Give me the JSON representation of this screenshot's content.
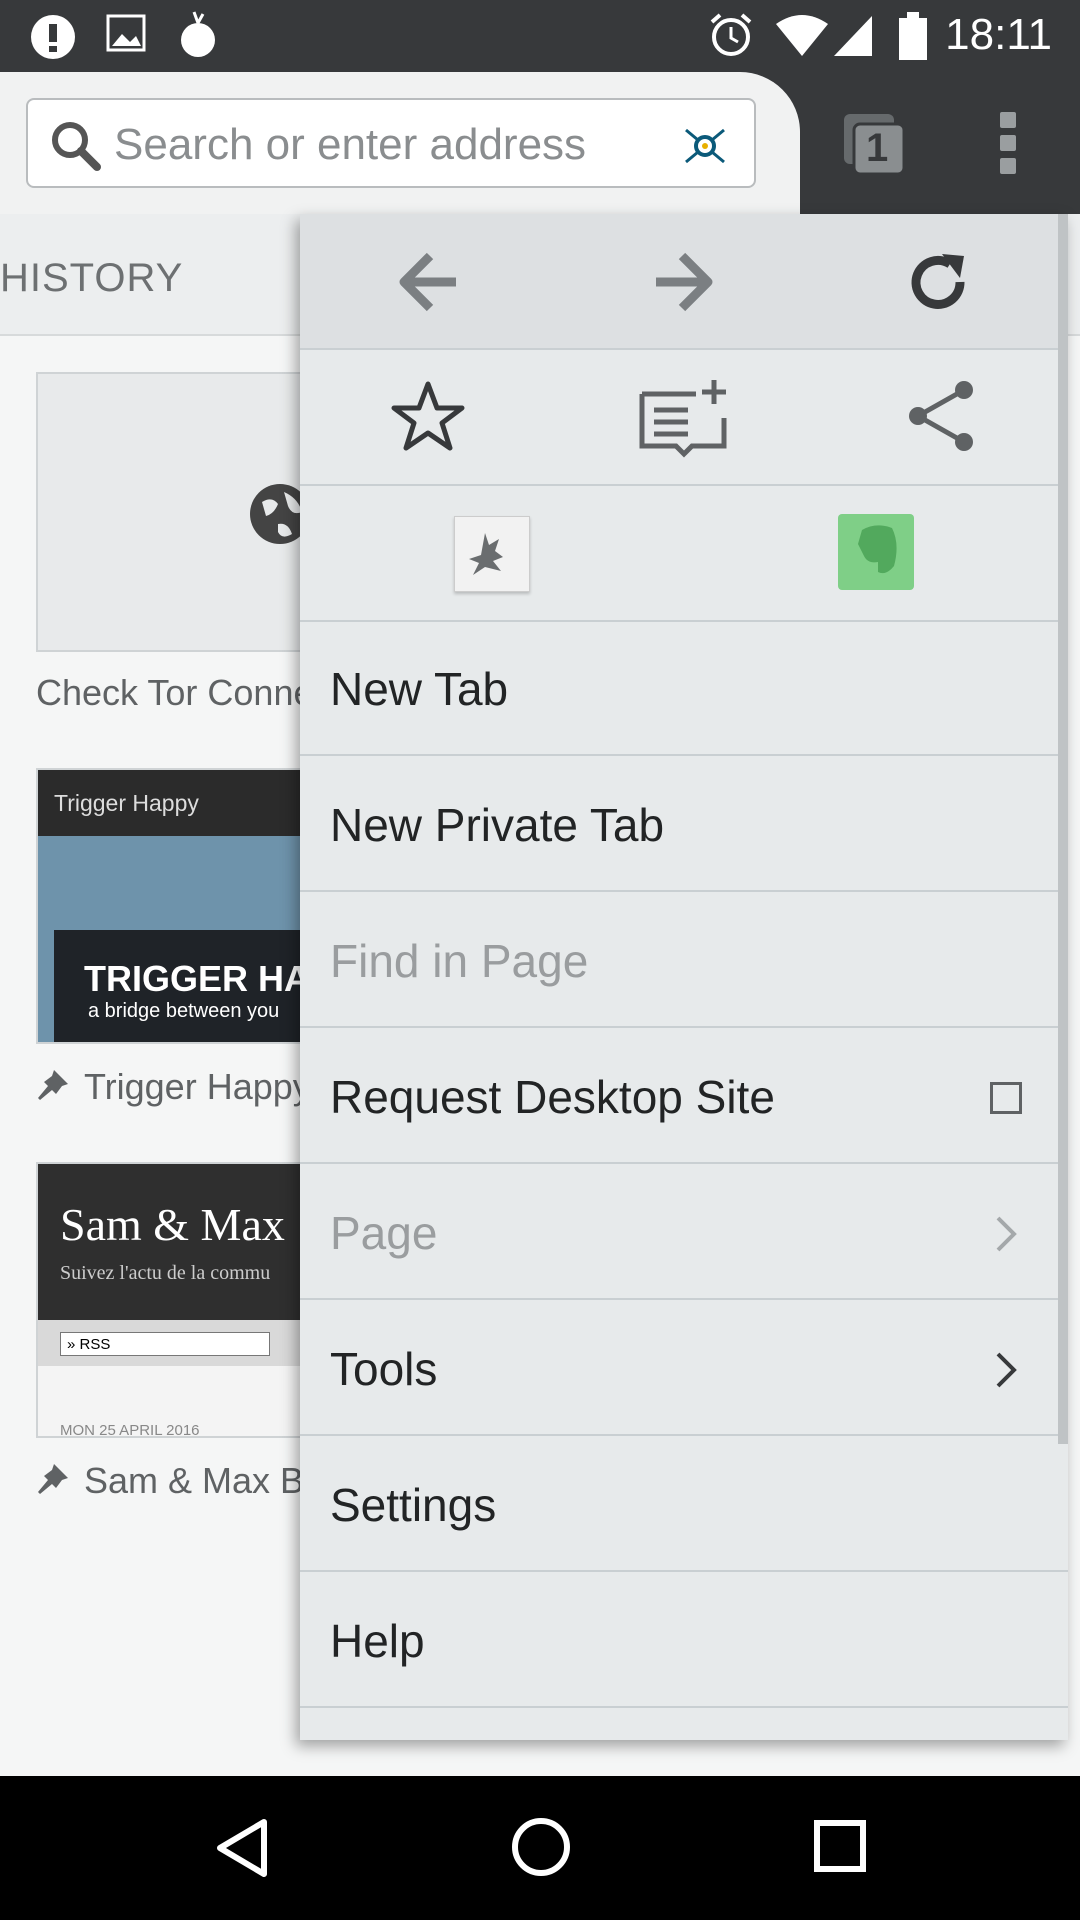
{
  "status_bar": {
    "time": "18:11"
  },
  "toolbar": {
    "search_placeholder": "Search or enter address",
    "tab_count": "1"
  },
  "background_page": {
    "tab_label": "HISTORY",
    "tiles": [
      {
        "caption": "Check Tor Conne"
      },
      {
        "thumb_header": "Trigger Happy",
        "thumb_title": "TRIGGER HA",
        "thumb_subtitle": "a bridge between you",
        "caption": "Trigger Happy"
      },
      {
        "thumb_title": "Sam & Max",
        "thumb_subtitle": "Suivez l'actu de la commu",
        "thumb_select": "» RSS",
        "thumb_date": "MON 25 APRIL 2016",
        "caption": "Sam & Max Bl"
      }
    ]
  },
  "menu": {
    "items": [
      {
        "label": "New Tab"
      },
      {
        "label": "New Private Tab"
      },
      {
        "label": "Find in Page"
      },
      {
        "label": "Request Desktop Site"
      },
      {
        "label": "Page"
      },
      {
        "label": "Tools"
      },
      {
        "label": "Settings"
      },
      {
        "label": "Help"
      }
    ]
  },
  "icons": {
    "search": "search-icon",
    "tor_onion": "tor-onion-icon",
    "tabs": "tabs-counter-icon",
    "overflow": "overflow-menu-icon",
    "back": "back-arrow-icon",
    "forward": "forward-arrow-icon",
    "reload": "reload-icon",
    "bookmark": "star-icon",
    "reading_list": "reading-list-add-icon",
    "share": "share-icon",
    "addon_1": "kangaroo-addon-icon",
    "addon_2": "evernote-icon"
  },
  "colors": {
    "chrome_dark": "#37393b",
    "menu_bg": "#e7eaeb",
    "evernote_green": "#7fcf87"
  }
}
